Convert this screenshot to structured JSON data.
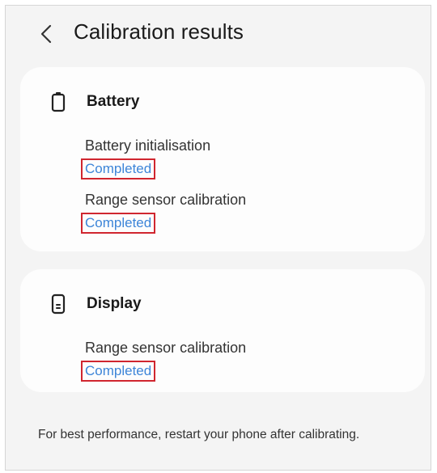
{
  "header": {
    "back_icon": "chevron-left-icon",
    "title": "Calibration results"
  },
  "battery_card": {
    "icon": "battery-icon",
    "title": "Battery",
    "items": [
      {
        "label": "Battery initialisation",
        "status": "Completed"
      },
      {
        "label": "Range sensor calibration",
        "status": "Completed"
      }
    ]
  },
  "display_card": {
    "icon": "phone-display-icon",
    "title": "Display",
    "items": [
      {
        "label": "Range sensor calibration",
        "status": "Completed"
      }
    ]
  },
  "footer": {
    "note": "For best performance, restart your phone after calibrating."
  },
  "colors": {
    "background": "#f4f4f4",
    "card": "#fdfdfd",
    "status_text": "#3d85d8",
    "highlight_box": "#d0262f"
  }
}
